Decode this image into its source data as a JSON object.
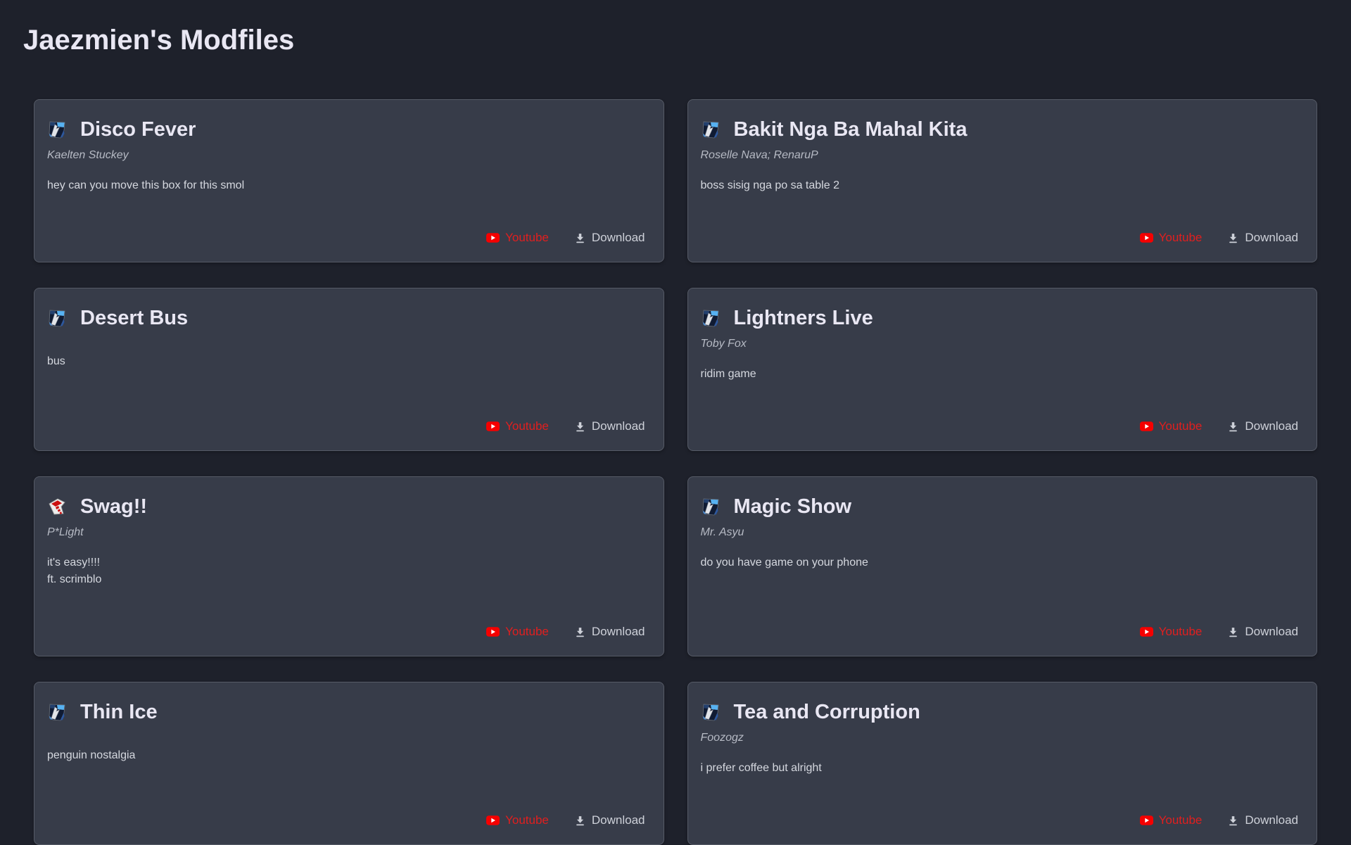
{
  "page": {
    "title": "Jaezmien's Modfiles"
  },
  "colors": {
    "background": "#1e212b",
    "card_background": "#373c49",
    "card_border": "#565b67",
    "heading_text": "#e9e7f3",
    "artist_text": "#b6bac4",
    "description_text": "#d5d8df",
    "youtube_red": "#e01f1f",
    "download_text": "#ced1d9"
  },
  "card_actions": {
    "youtube_label": "Youtube",
    "download_label": "Download",
    "youtube_icon": "youtube-play-icon",
    "download_icon": "download-arrow-icon"
  },
  "cards": [
    {
      "title": "Disco Fever",
      "artist": "Kaelten Stuckey",
      "description_lines": [
        "hey can you move this box for this smol"
      ],
      "icon": "broken-image-blue-icon"
    },
    {
      "title": "Bakit Nga Ba Mahal Kita",
      "artist": "Roselle Nava; RenaruP",
      "description_lines": [
        "boss sisig nga po sa table 2"
      ],
      "icon": "broken-image-blue-icon"
    },
    {
      "title": "Desert Bus",
      "artist": "",
      "description_lines": [
        "bus"
      ],
      "icon": "broken-image-blue-icon"
    },
    {
      "title": "Lightners Live",
      "artist": "Toby Fox",
      "description_lines": [
        "ridim game"
      ],
      "icon": "broken-image-blue-icon"
    },
    {
      "title": "Swag!!",
      "artist": "P*Light",
      "description_lines": [
        "it's easy!!!!",
        "ft. scrimblo"
      ],
      "icon": "broken-image-red-icon"
    },
    {
      "title": "Magic Show",
      "artist": "Mr. Asyu",
      "description_lines": [
        "do you have game on your phone"
      ],
      "icon": "broken-image-blue-icon"
    },
    {
      "title": "Thin Ice",
      "artist": "",
      "description_lines": [
        "penguin nostalgia"
      ],
      "icon": "broken-image-blue-icon"
    },
    {
      "title": "Tea and Corruption",
      "artist": "Foozogz",
      "description_lines": [
        "i prefer coffee but alright"
      ],
      "icon": "broken-image-blue-icon"
    }
  ]
}
